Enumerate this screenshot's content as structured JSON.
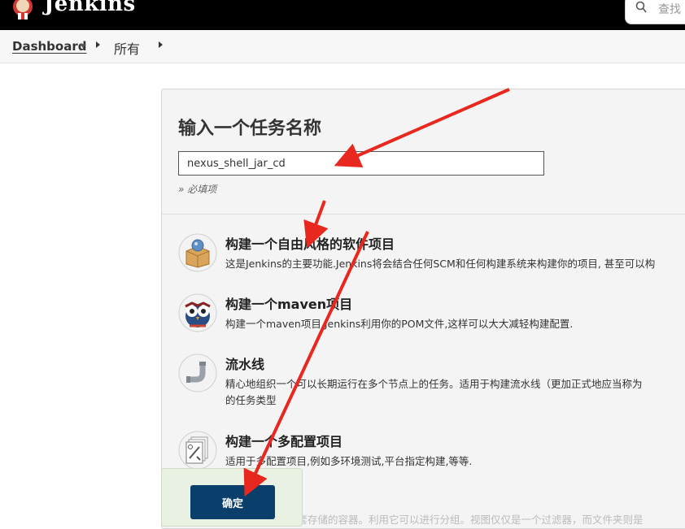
{
  "header": {
    "brand": "Jenkins",
    "search_placeholder": "查找"
  },
  "breadcrumb": {
    "dashboard": "Dashboard",
    "all": "所有"
  },
  "form": {
    "title": "输入一个任务名称",
    "item_name": "nexus_shell_jar_cd",
    "required_hint": "» 必填项"
  },
  "items": [
    {
      "title": "构建一个自由风格的软件项目",
      "desc": "这是Jenkins的主要功能.Jenkins将会结合任何SCM和任何构建系统来构建你的项目, 甚至可以构",
      "icon": "freestyle-box-icon"
    },
    {
      "title": "构建一个maven项目",
      "desc": "构建一个maven项目.Jenkins利用你的POM文件,这样可以大大减轻构建配置.",
      "icon": "maven-owl-icon"
    },
    {
      "title": "流水线",
      "desc": "精心地组织一个可以长期运行在多个节点上的任务。适用于构建流水线（更加正式地应当称为",
      "desc2": "的任务类型",
      "icon": "pipeline-icon"
    },
    {
      "title": "构建一个多配置项目",
      "desc": "适用于多配置项目,例如多环境测试,平台指定构建,等等.",
      "icon": "multiconfig-icon"
    }
  ],
  "confirm_label": "确定",
  "bottom_desc": "创建一个可以嵌套存储的容器。利用它可以进行分组。视图仅仅是一个过滤器，而文件夹则是",
  "colors": {
    "header": "#000000",
    "button": "#0a3f6b",
    "arrow": "#e8281e"
  }
}
